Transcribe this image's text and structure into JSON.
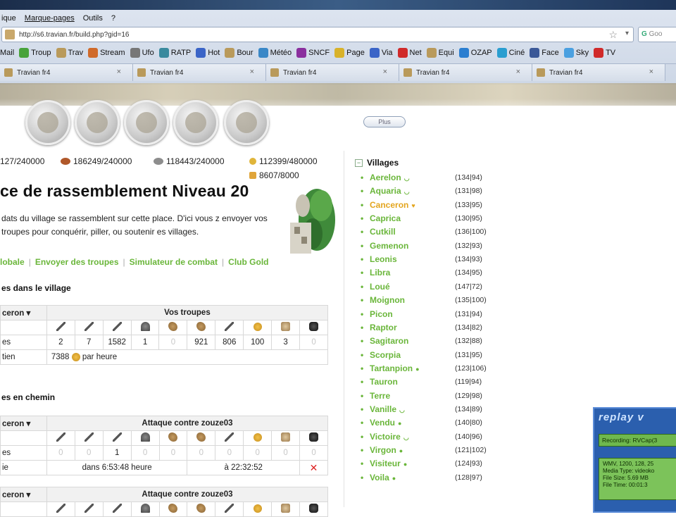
{
  "browser": {
    "menu": [
      "ique",
      "Marque-pages",
      "Outils",
      "?"
    ],
    "url": "http://s6.travian.fr/build.php?gid=16",
    "search_placeholder": "Goo",
    "bookmarks": [
      {
        "label": "Mail",
        "color": "#4a7ed9"
      },
      {
        "label": "Troup",
        "color": "#48a33b"
      },
      {
        "label": "Trav",
        "color": "#b99a5b"
      },
      {
        "label": "Stream",
        "color": "#d06a2a"
      },
      {
        "label": "Ufo",
        "color": "#777777"
      },
      {
        "label": "RATP",
        "color": "#3a8a9e"
      },
      {
        "label": "Hot",
        "color": "#3a64c7"
      },
      {
        "label": "Bour",
        "color": "#b99a5b"
      },
      {
        "label": "Météo",
        "color": "#3a88c7"
      },
      {
        "label": "SNCF",
        "color": "#8a2f9e"
      },
      {
        "label": "Page",
        "color": "#d8b22a"
      },
      {
        "label": "Via",
        "color": "#3a64c7"
      },
      {
        "label": "Net",
        "color": "#d02a2a"
      },
      {
        "label": "Equi",
        "color": "#b99a5b"
      },
      {
        "label": "OZAP",
        "color": "#2a7ed0"
      },
      {
        "label": "Ciné",
        "color": "#2a9ed0"
      },
      {
        "label": "Face",
        "color": "#3b5998"
      },
      {
        "label": "Sky",
        "color": "#4aa0e0"
      },
      {
        "label": "TV",
        "color": "#d02a2a"
      }
    ],
    "tabs": [
      "Travian fr4",
      "Travian fr4",
      "Travian fr4",
      "Travian fr4",
      "Travian fr4"
    ],
    "plus_label": "Plus"
  },
  "resources": {
    "wood": "127/240000",
    "clay": "186249/240000",
    "iron": "118443/240000",
    "crop": "112399/480000",
    "consumption": "8607/8000"
  },
  "page": {
    "title": "ce de rassemblement Niveau 20",
    "intro": "dats du village se rassemblent sur cette place. D'ici vous z envoyer vos troupes pour conquérir, piller, ou soutenir es villages.",
    "links": [
      "lobale",
      "Envoyer des troupes",
      "Simulateur de combat",
      "Club Gold"
    ],
    "section_village": "es dans le village",
    "section_way": "es en chemin"
  },
  "own_troops": {
    "village_label": "ceron ▾",
    "header": "Vos troupes",
    "row_label": "es",
    "values": [
      "2",
      "7",
      "1582",
      "1",
      "0",
      "921",
      "806",
      "100",
      "3",
      "0"
    ],
    "upkeep_label": "tien",
    "upkeep_value": "7388",
    "upkeep_unit": "par heure"
  },
  "movement1": {
    "village_label": "ceron ▾",
    "header": "Attaque contre zouze03",
    "row_label": "es",
    "values": [
      "0",
      "0",
      "1",
      "0",
      "0",
      "0",
      "0",
      "0",
      "0",
      "0"
    ],
    "arrival_label": "ie",
    "duration": "dans 6:53:48 heure",
    "arrival": "à 22:32:52"
  },
  "movement2": {
    "village_label": "ceron ▾",
    "header": "Attaque contre zouze03"
  },
  "unit_icons": [
    "sword-icon",
    "sword-icon",
    "sword-icon",
    "helmet-icon",
    "horse-icon",
    "horse-icon",
    "ram-icon",
    "catapult-icon",
    "chief-icon",
    "settler-icon"
  ],
  "villages": {
    "title": "Villages",
    "list": [
      {
        "name": "Aerelon",
        "coords": "(134|94)",
        "mark": "◡"
      },
      {
        "name": "Aquaria",
        "coords": "(131|98)",
        "mark": "◡"
      },
      {
        "name": "Canceron",
        "coords": "(133|95)",
        "mark": "♥",
        "current": true
      },
      {
        "name": "Caprica",
        "coords": "(130|95)"
      },
      {
        "name": "Cutkill",
        "coords": "(136|100)"
      },
      {
        "name": "Gemenon",
        "coords": "(132|93)"
      },
      {
        "name": "Leonis",
        "coords": "(134|93)"
      },
      {
        "name": "Libra",
        "coords": "(134|95)"
      },
      {
        "name": "Loué",
        "coords": "(147|72)"
      },
      {
        "name": "Moignon",
        "coords": "(135|100)"
      },
      {
        "name": "Picon",
        "coords": "(131|94)"
      },
      {
        "name": "Raptor",
        "coords": "(134|82)"
      },
      {
        "name": "Sagitaron",
        "coords": "(132|88)"
      },
      {
        "name": "Scorpia",
        "coords": "(131|95)"
      },
      {
        "name": "Tartanpion",
        "coords": "(123|106)",
        "mark": "●"
      },
      {
        "name": "Tauron",
        "coords": "(119|94)"
      },
      {
        "name": "Terre",
        "coords": "(129|98)"
      },
      {
        "name": "Vanille",
        "coords": "(134|89)",
        "mark": "◡"
      },
      {
        "name": "Vendu",
        "coords": "(140|80)",
        "mark": "●"
      },
      {
        "name": "Victoire",
        "coords": "(140|96)",
        "mark": "◡"
      },
      {
        "name": "Virgon",
        "coords": "(121|102)",
        "mark": "●"
      },
      {
        "name": "Visiteur",
        "coords": "(124|93)",
        "mark": "●"
      },
      {
        "name": "Voila",
        "coords": "(128|97)",
        "mark": "●"
      }
    ]
  },
  "replay": {
    "title": "replay v",
    "recording": "Recording: RVCap(3",
    "info_lines": [
      "WMV, 1200, 128, 25",
      "Media Type: videoko",
      "File Size: 5.69 MB",
      "File Time: 00:01:3"
    ]
  }
}
